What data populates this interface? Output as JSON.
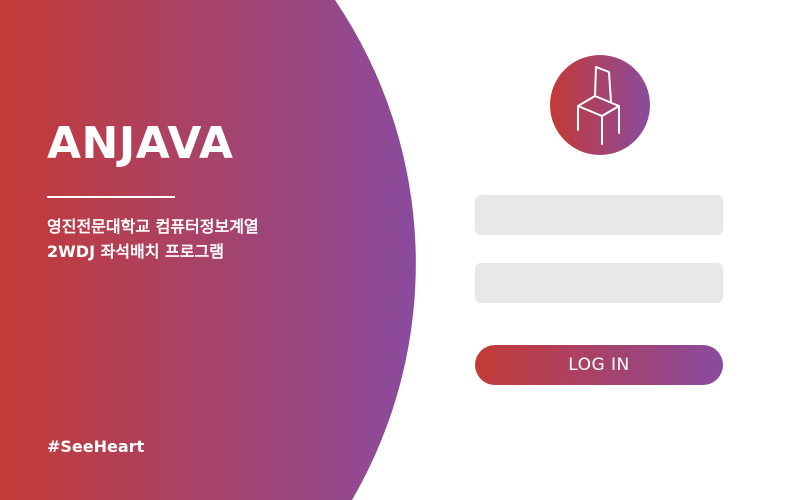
{
  "brand": {
    "title": "ANJAVA",
    "subtitle_line1": "영진전문대학교 컴퓨터정보계열",
    "subtitle_line2": "2WDJ 좌석배치 프로그램",
    "hashtag": "#SeeHeart"
  },
  "login": {
    "username_value": "",
    "password_value": "",
    "button_label": "LOG IN",
    "logo_icon": "chair-icon"
  },
  "colors": {
    "gradient_start": "#c43a36",
    "gradient_end": "#8a4b9e",
    "field_background": "#e8e8e8",
    "background": "#ffffff"
  }
}
